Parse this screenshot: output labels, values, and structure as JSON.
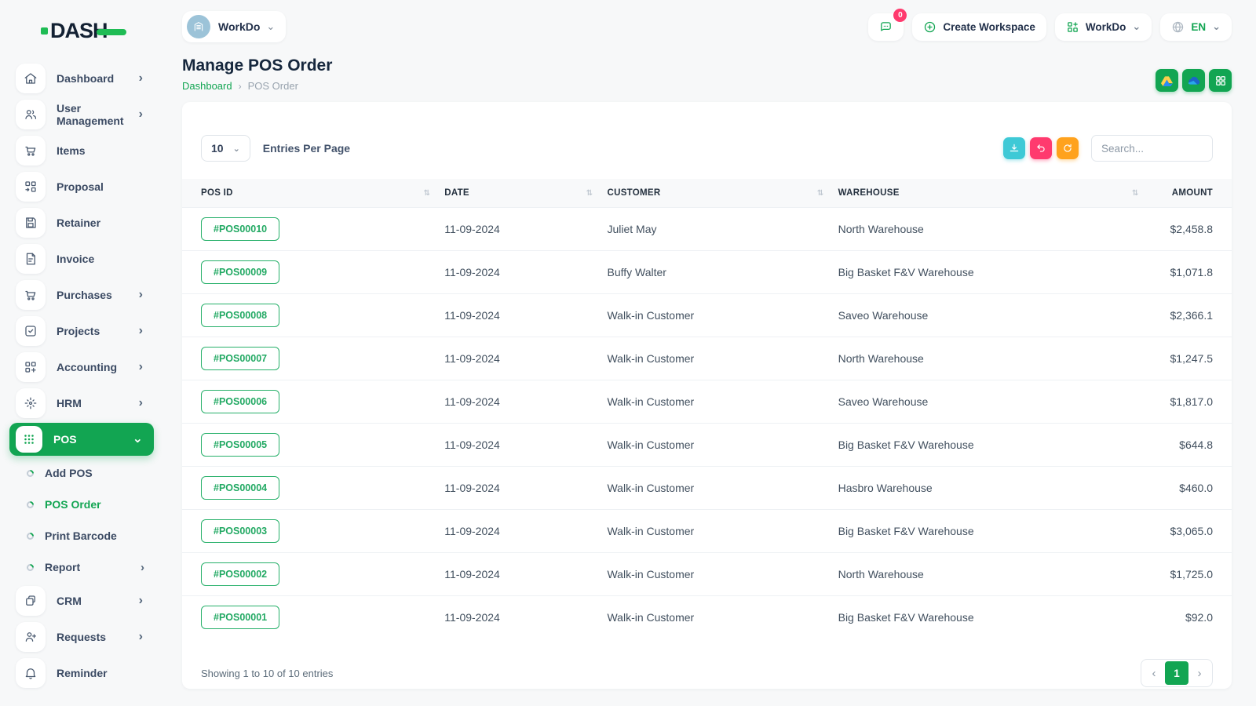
{
  "brand": {
    "name": "DASH"
  },
  "topbar": {
    "workspace_label": "WorkDo",
    "chat_badge": "0",
    "create_workspace_label": "Create Workspace",
    "workspace_menu_label": "WorkDo",
    "language": "EN"
  },
  "page": {
    "title": "Manage POS Order",
    "breadcrumb_home": "Dashboard",
    "breadcrumb_current": "POS Order"
  },
  "sidebar": {
    "items": [
      {
        "label": "Dashboard"
      },
      {
        "label": "User Management"
      },
      {
        "label": "Items"
      },
      {
        "label": "Proposal"
      },
      {
        "label": "Retainer"
      },
      {
        "label": "Invoice"
      },
      {
        "label": "Purchases"
      },
      {
        "label": "Projects"
      },
      {
        "label": "Accounting"
      },
      {
        "label": "HRM"
      },
      {
        "label": "POS"
      },
      {
        "label": "CRM"
      },
      {
        "label": "Requests"
      },
      {
        "label": "Reminder"
      }
    ],
    "pos_submenu": [
      {
        "label": "Add POS"
      },
      {
        "label": "POS Order"
      },
      {
        "label": "Print Barcode"
      },
      {
        "label": "Report"
      }
    ]
  },
  "toolbar": {
    "entries_value": "10",
    "entries_label": "Entries Per Page",
    "search_placeholder": "Search..."
  },
  "table": {
    "headers": [
      "POS ID",
      "DATE",
      "CUSTOMER",
      "WAREHOUSE",
      "AMOUNT"
    ],
    "rows": [
      {
        "pos_id": "#POS00010",
        "date": "11-09-2024",
        "customer": "Juliet May",
        "warehouse": "North Warehouse",
        "amount": "$2,458.8"
      },
      {
        "pos_id": "#POS00009",
        "date": "11-09-2024",
        "customer": "Buffy Walter",
        "warehouse": "Big Basket F&V Warehouse",
        "amount": "$1,071.8"
      },
      {
        "pos_id": "#POS00008",
        "date": "11-09-2024",
        "customer": "Walk-in Customer",
        "warehouse": "Saveo Warehouse",
        "amount": "$2,366.1"
      },
      {
        "pos_id": "#POS00007",
        "date": "11-09-2024",
        "customer": "Walk-in Customer",
        "warehouse": "North Warehouse",
        "amount": "$1,247.5"
      },
      {
        "pos_id": "#POS00006",
        "date": "11-09-2024",
        "customer": "Walk-in Customer",
        "warehouse": "Saveo Warehouse",
        "amount": "$1,817.0"
      },
      {
        "pos_id": "#POS00005",
        "date": "11-09-2024",
        "customer": "Walk-in Customer",
        "warehouse": "Big Basket F&V Warehouse",
        "amount": "$644.8"
      },
      {
        "pos_id": "#POS00004",
        "date": "11-09-2024",
        "customer": "Walk-in Customer",
        "warehouse": "Hasbro Warehouse",
        "amount": "$460.0"
      },
      {
        "pos_id": "#POS00003",
        "date": "11-09-2024",
        "customer": "Walk-in Customer",
        "warehouse": "Big Basket F&V Warehouse",
        "amount": "$3,065.0"
      },
      {
        "pos_id": "#POS00002",
        "date": "11-09-2024",
        "customer": "Walk-in Customer",
        "warehouse": "North Warehouse",
        "amount": "$1,725.0"
      },
      {
        "pos_id": "#POS00001",
        "date": "11-09-2024",
        "customer": "Walk-in Customer",
        "warehouse": "Big Basket F&V Warehouse",
        "amount": "$92.0"
      }
    ]
  },
  "footer": {
    "showing": "Showing 1 to 10 of 10 entries",
    "page": "1"
  },
  "icons": {
    "chevron_right": "›",
    "chevron_down": "⌄",
    "sort": "⇅",
    "prev": "‹",
    "next": "›"
  },
  "colors": {
    "primary": "#12a552",
    "info": "#3ec9d6",
    "danger": "#ff3a6e",
    "warning": "#ffa21d",
    "logo_navy": "#132133",
    "logo_green": "#1fbc55"
  }
}
